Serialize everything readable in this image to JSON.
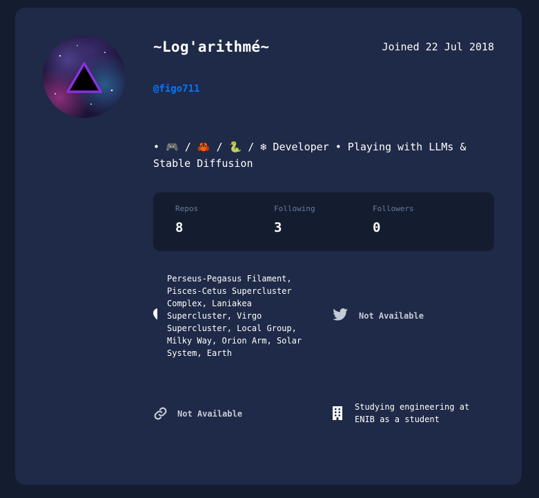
{
  "profile": {
    "name": "~Log'arithmé~",
    "joined": "Joined 22 Jul 2018",
    "login": "@figo711",
    "bio": "• 🎮 / 🦀 / 🐍 / ❄ Developer • Playing with LLMs & Stable Diffusion"
  },
  "stats": {
    "repos_label": "Repos",
    "repos_value": "8",
    "following_label": "Following",
    "following_value": "3",
    "followers_label": "Followers",
    "followers_value": "0"
  },
  "info": {
    "location": "Perseus-Pegasus Filament, Pisces-Cetus Supercluster Complex, Laniakea Supercluster, Virgo Supercluster, Local Group, Milky Way, Orion Arm, Solar System, Earth",
    "twitter": "Not Available",
    "blog": "Not Available",
    "company": "Studying engineering at ENIB as a student"
  },
  "icons": {
    "location": "location-pin-icon",
    "twitter": "twitter-icon",
    "blog": "link-icon",
    "company": "building-icon"
  },
  "colors": {
    "background": "#141d2f",
    "card": "#1e2a47",
    "accent": "#0079ff",
    "muted": "#697c9a",
    "text": "#ffffff"
  }
}
